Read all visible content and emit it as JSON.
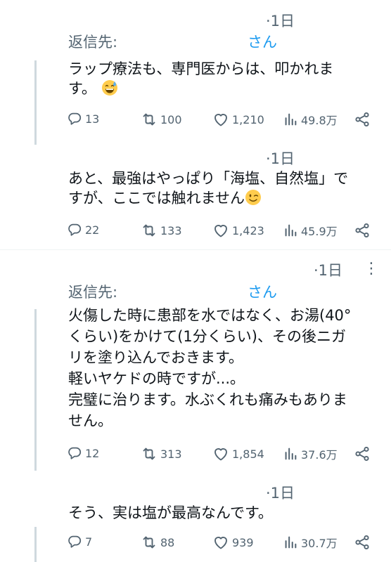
{
  "tweets": [
    {
      "time": "·1日",
      "reply_label": "返信先:",
      "reply_name": "さん",
      "text": "ラップ療法も、専門医からは、叩かれま\nす。",
      "emoji": "sweat-smile",
      "replies": "13",
      "retweets": "100",
      "likes": "1,210",
      "views": "49.8万"
    },
    {
      "time": "·1日",
      "text": "あと、最強はやっぱり「海塩、自然塩」で\nすが、ここでは触れません",
      "emoji": "wink",
      "replies": "22",
      "retweets": "133",
      "likes": "1,423",
      "views": "45.9万"
    },
    {
      "time": "·1日",
      "more": "⋮",
      "reply_label": "返信先:",
      "reply_name": "さん",
      "text": "火傷した時に患部を水ではなく、お湯(40°\nくらい)をかけて(1分くらい)、その後ニガ\nリを塗り込んでおきます。\n軽いヤケドの時ですが...。\n完璧に治ります。水ぶくれも痛みもありま\nせん。",
      "replies": "12",
      "retweets": "313",
      "likes": "1,854",
      "views": "37.6万"
    },
    {
      "time": "·1日",
      "text": "そう、実は塩が最高なんです。",
      "replies": "7",
      "retweets": "88",
      "likes": "939",
      "views": "30.7万"
    }
  ],
  "colors": {
    "text": "#0f1419",
    "muted": "#536471",
    "link": "#1d9bf0",
    "line": "#cfd9de"
  }
}
